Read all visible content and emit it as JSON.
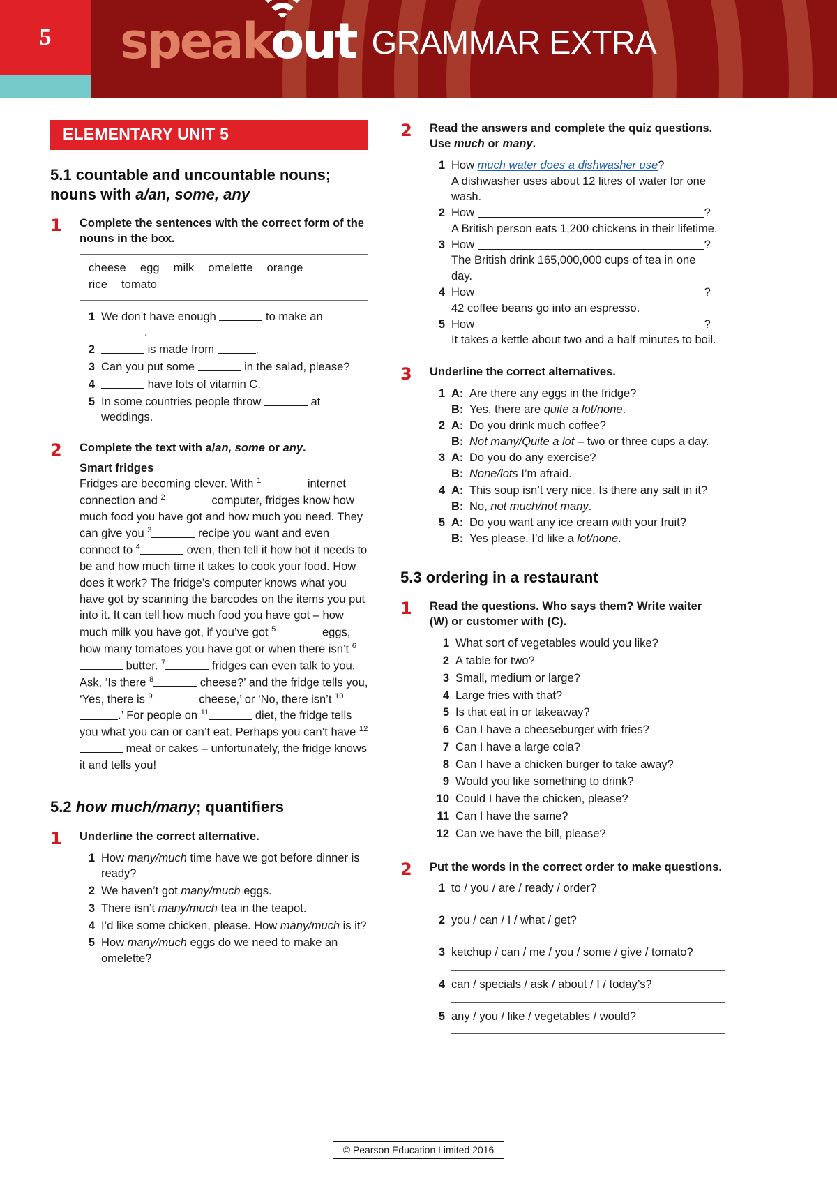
{
  "header": {
    "unit_number": "5",
    "logo_speak": "speak",
    "logo_out": "out",
    "title": "GRAMMAR EXTRA",
    "colors": {
      "dark_red": "#8c1111",
      "ring_red": "#a83a2c",
      "bright_red": "#e02128",
      "teal": "#74cbc9",
      "logo_salmon": "#df7f63"
    }
  },
  "unit_banner": "ELEMENTARY UNIT 5",
  "sections": {
    "s51": {
      "heading_main": "5.1 countable and uncountable nouns;",
      "heading_sub_pre": "nouns with ",
      "heading_sub_em": "a/an, some, any",
      "ex1": {
        "num": "1",
        "instruction": "Complete the sentences with the correct form of the nouns in the box.",
        "wordbox": [
          "cheese",
          "egg",
          "milk",
          "omelette",
          "orange",
          "rice",
          "tomato"
        ],
        "items": [
          {
            "n": "1",
            "pre": "We don’t have enough ",
            "mid": " to make an ",
            "post": "."
          },
          {
            "n": "2",
            "pre": "",
            "mid": " is made from ",
            "post": "."
          },
          {
            "n": "3",
            "pre": "Can you put some ",
            "mid": " in the salad, please?",
            "post": ""
          },
          {
            "n": "4",
            "pre": "",
            "mid": " have lots of vitamin C.",
            "post": ""
          },
          {
            "n": "5",
            "pre": "In some countries people throw ",
            "mid": " at weddings.",
            "post": ""
          }
        ]
      },
      "ex2": {
        "num": "2",
        "instruction_pre": "Complete the text with a/",
        "instruction_em1": "an, some",
        "instruction_mid": " or ",
        "instruction_em2": "any",
        "instruction_post": ".",
        "text_title": "Smart fridges",
        "text_parts": [
          "Fridges are becoming clever. With ",
          " internet connection and ",
          " computer, fridges know how much food you have got and how much you need. They can give you ",
          " recipe you want and even connect to ",
          " oven, then tell it how hot it needs to be and how much time it takes to cook your food. How does it work? The fridge’s computer knows what you have got by scanning the barcodes on the items you put into it. It can tell how much food you have got – how much milk you have got, if you’ve got ",
          " eggs, how many tomatoes you have got or when there isn’t ",
          " butter. ",
          " fridges can even talk to you. Ask, ‘Is there ",
          " cheese?’ and the fridge tells you, ‘Yes, there is ",
          " cheese,’ or ‘No, there isn’t ",
          ".’ For people on ",
          " diet, the fridge tells you what you can or can’t eat. Perhaps you can’t have ",
          " meat or cakes – unfortunately, the fridge knows it and tells you!"
        ]
      }
    },
    "s52": {
      "heading_pre": "5.2 ",
      "heading_em": "how much/many",
      "heading_post": "; quantifiers",
      "ex1": {
        "num": "1",
        "instruction": "Underline the correct alternative.",
        "items": [
          {
            "n": "1",
            "pre": "How ",
            "em": "many/much",
            "post": " time have we got before dinner is ready?"
          },
          {
            "n": "2",
            "pre": "We haven’t got ",
            "em": "many/much",
            "post": " eggs."
          },
          {
            "n": "3",
            "pre": "There isn’t ",
            "em": "many/much",
            "post": " tea in the teapot."
          },
          {
            "n": "4",
            "pre": "I’d like some chicken, please. How ",
            "em": "many/much",
            "post": " is it?"
          },
          {
            "n": "5",
            "pre": "How ",
            "em": "many/much",
            "post": " eggs do we need to make an omelette?"
          }
        ]
      },
      "ex2": {
        "num": "2",
        "instruction_pre": "Read the answers and complete the quiz questions. Use ",
        "instruction_em1": "much",
        "instruction_mid": " or ",
        "instruction_em2": "many",
        "instruction_post": ".",
        "items": [
          {
            "n": "1",
            "q_pre": "How ",
            "q_filled": "much water does a dishwasher use",
            "q_post": "?",
            "answer": "A dishwasher uses about 12 litres of water for one wash."
          },
          {
            "n": "2",
            "q_pre": "How ",
            "q_filled": "",
            "q_post": "?",
            "answer": "A British person eats 1,200 chickens in their lifetime."
          },
          {
            "n": "3",
            "q_pre": "How ",
            "q_filled": "",
            "q_post": "?",
            "answer": "The British drink 165,000,000 cups of tea in one day."
          },
          {
            "n": "4",
            "q_pre": "How ",
            "q_filled": "",
            "q_post": "?",
            "answer": "42 coffee beans go into an espresso."
          },
          {
            "n": "5",
            "q_pre": "How ",
            "q_filled": "",
            "q_post": "?",
            "answer": "It takes a kettle about two and a half minutes to boil."
          }
        ]
      },
      "ex3": {
        "num": "3",
        "instruction": "Underline the correct alternatives.",
        "items": [
          {
            "n": "1",
            "a_label": "A:",
            "a_pre": "Are there any eggs in the fridge?",
            "a_em": "",
            "a_post": "",
            "b_label": "B:",
            "b_pre": "Yes, there are ",
            "b_em": "quite a lot/none",
            "b_post": "."
          },
          {
            "n": "2",
            "a_label": "A:",
            "a_pre": "Do you drink much coffee?",
            "a_em": "",
            "a_post": "",
            "b_label": "B:",
            "b_pre": "",
            "b_em": "Not many/Quite a lot",
            "b_post": " – two or three cups a day."
          },
          {
            "n": "3",
            "a_label": "A:",
            "a_pre": "Do you do any exercise?",
            "a_em": "",
            "a_post": "",
            "b_label": "B:",
            "b_pre": "",
            "b_em": "None/lots",
            "b_post": " I’m afraid."
          },
          {
            "n": "4",
            "a_label": "A:",
            "a_pre": "This soup isn’t very nice. Is there any salt in it?",
            "a_em": "",
            "a_post": "",
            "b_label": "B:",
            "b_pre": "No, ",
            "b_em": "not much/not many",
            "b_post": "."
          },
          {
            "n": "5",
            "a_label": "A:",
            "a_pre": "Do you want any ice cream with your fruit?",
            "a_em": "",
            "a_post": "",
            "b_label": "B:",
            "b_pre": "Yes please. I’d like a ",
            "b_em": "lot/none",
            "b_post": "."
          }
        ]
      }
    },
    "s53": {
      "heading": "5.3 ordering in a restaurant",
      "ex1": {
        "num": "1",
        "instruction": "Read the questions. Who says them? Write waiter (W) or customer with (C).",
        "items": [
          {
            "n": "1",
            "t": "What sort of vegetables would you like?"
          },
          {
            "n": "2",
            "t": "A table for two?"
          },
          {
            "n": "3",
            "t": "Small, medium or large?"
          },
          {
            "n": "4",
            "t": "Large fries with that?"
          },
          {
            "n": "5",
            "t": "Is that eat in or takeaway?"
          },
          {
            "n": "6",
            "t": "Can I have a cheeseburger with fries?"
          },
          {
            "n": "7",
            "t": "Can I have a large cola?"
          },
          {
            "n": "8",
            "t": "Can I have a chicken burger to take away?"
          },
          {
            "n": "9",
            "t": "Would you like something to drink?"
          },
          {
            "n": "10",
            "t": "Could I have the chicken, please?"
          },
          {
            "n": "11",
            "t": "Can I have the same?"
          },
          {
            "n": "12",
            "t": "Can we have the bill, please?"
          }
        ]
      },
      "ex2": {
        "num": "2",
        "instruction": "Put the words in the correct order to make questions.",
        "items": [
          {
            "n": "1",
            "t": "to / you / are / ready / order?"
          },
          {
            "n": "2",
            "t": "you / can / I / what / get?"
          },
          {
            "n": "3",
            "t": "ketchup / can / me / you / some / give / tomato?"
          },
          {
            "n": "4",
            "t": "can / specials / ask / about / I / today’s?"
          },
          {
            "n": "5",
            "t": "any / you / like / vegetables / would?"
          }
        ]
      }
    }
  },
  "footer": {
    "copyright": "© Pearson Education Limited 2016"
  }
}
